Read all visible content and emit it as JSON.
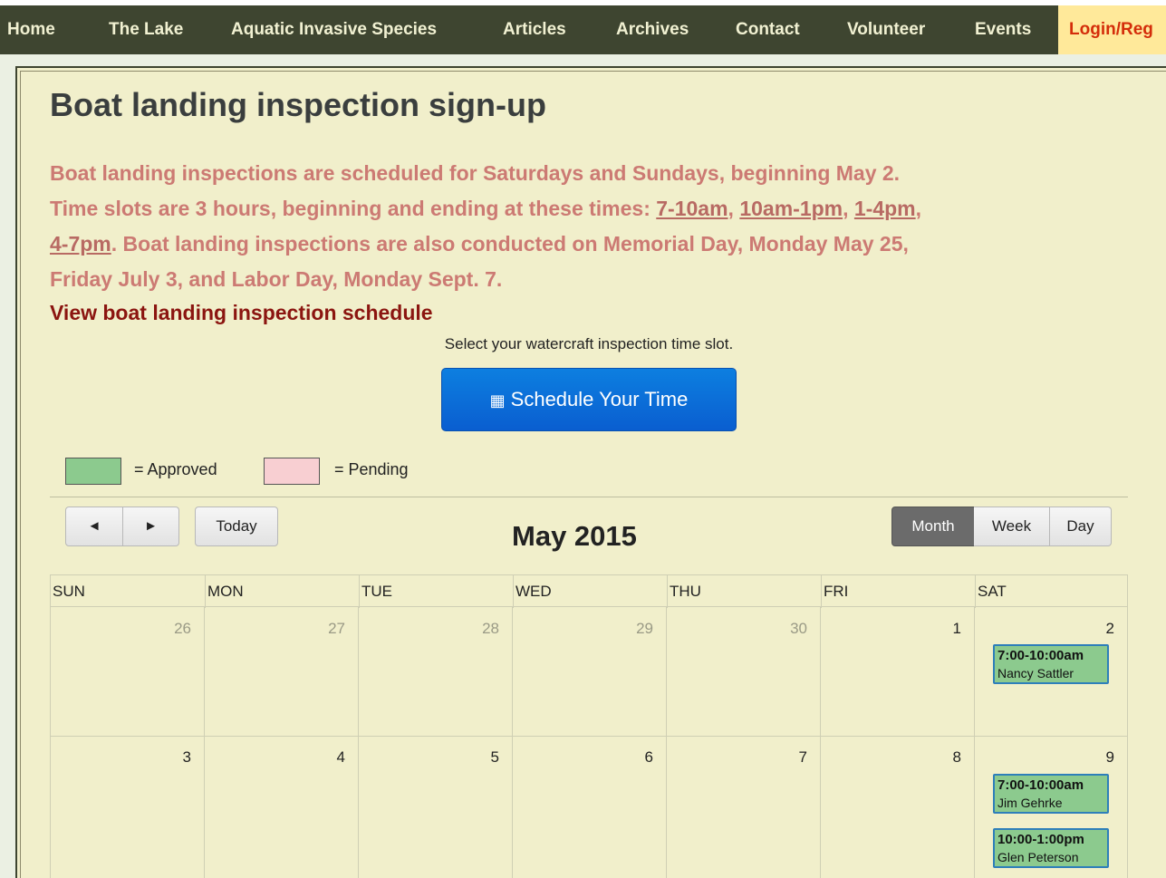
{
  "nav": {
    "items": [
      "Home",
      "The Lake",
      "Aquatic Invasive Species",
      "Articles",
      "Archives",
      "Contact",
      "Volunteer",
      "Events"
    ],
    "login": "Login/Reg"
  },
  "page": {
    "title": "Boat landing inspection sign-up",
    "intro": {
      "line1": "Boat landing inspections are scheduled for Saturdays and Sundays, beginning May 2.",
      "line2_prefix": "Time slots are 3 hours, beginning and ending at these times: ",
      "slots": [
        "7-10am",
        "10am-1pm",
        "1-4pm",
        "4-7pm"
      ],
      "sep": ", ",
      "line3_suffix": ". Boat landing inspections are also conducted on Memorial Day, Monday May 25,",
      "line4": "Friday July 3, and Labor Day, Monday Sept. 7."
    },
    "view_schedule_link": "View boat landing inspection schedule",
    "select_text": "Select your watercraft inspection time slot.",
    "schedule_button": "Schedule Your Time"
  },
  "legend": {
    "approved_label": "= Approved",
    "pending_label": "= Pending",
    "approved_color": "#8cca8e",
    "pending_color": "#f8cfd2"
  },
  "calendar": {
    "prev_glyph": "◄",
    "next_glyph": "►",
    "today_label": "Today",
    "title": "May 2015",
    "views": [
      "Month",
      "Week",
      "Day"
    ],
    "active_view": "Month",
    "days_of_week": [
      "SUN",
      "MON",
      "TUE",
      "WED",
      "THU",
      "FRI",
      "SAT"
    ],
    "weeks": [
      [
        "26",
        "27",
        "28",
        "29",
        "30",
        "1",
        "2"
      ],
      [
        "3",
        "4",
        "5",
        "6",
        "7",
        "8",
        "9"
      ]
    ],
    "events": {
      "may2": [
        {
          "time": "7:00-10:00am",
          "name": "Nancy Sattler"
        }
      ],
      "may9": [
        {
          "time": "7:00-10:00am",
          "name": "Jim Gehrke"
        },
        {
          "time": "10:00-1:00pm",
          "name": "Glen Peterson"
        }
      ]
    }
  }
}
